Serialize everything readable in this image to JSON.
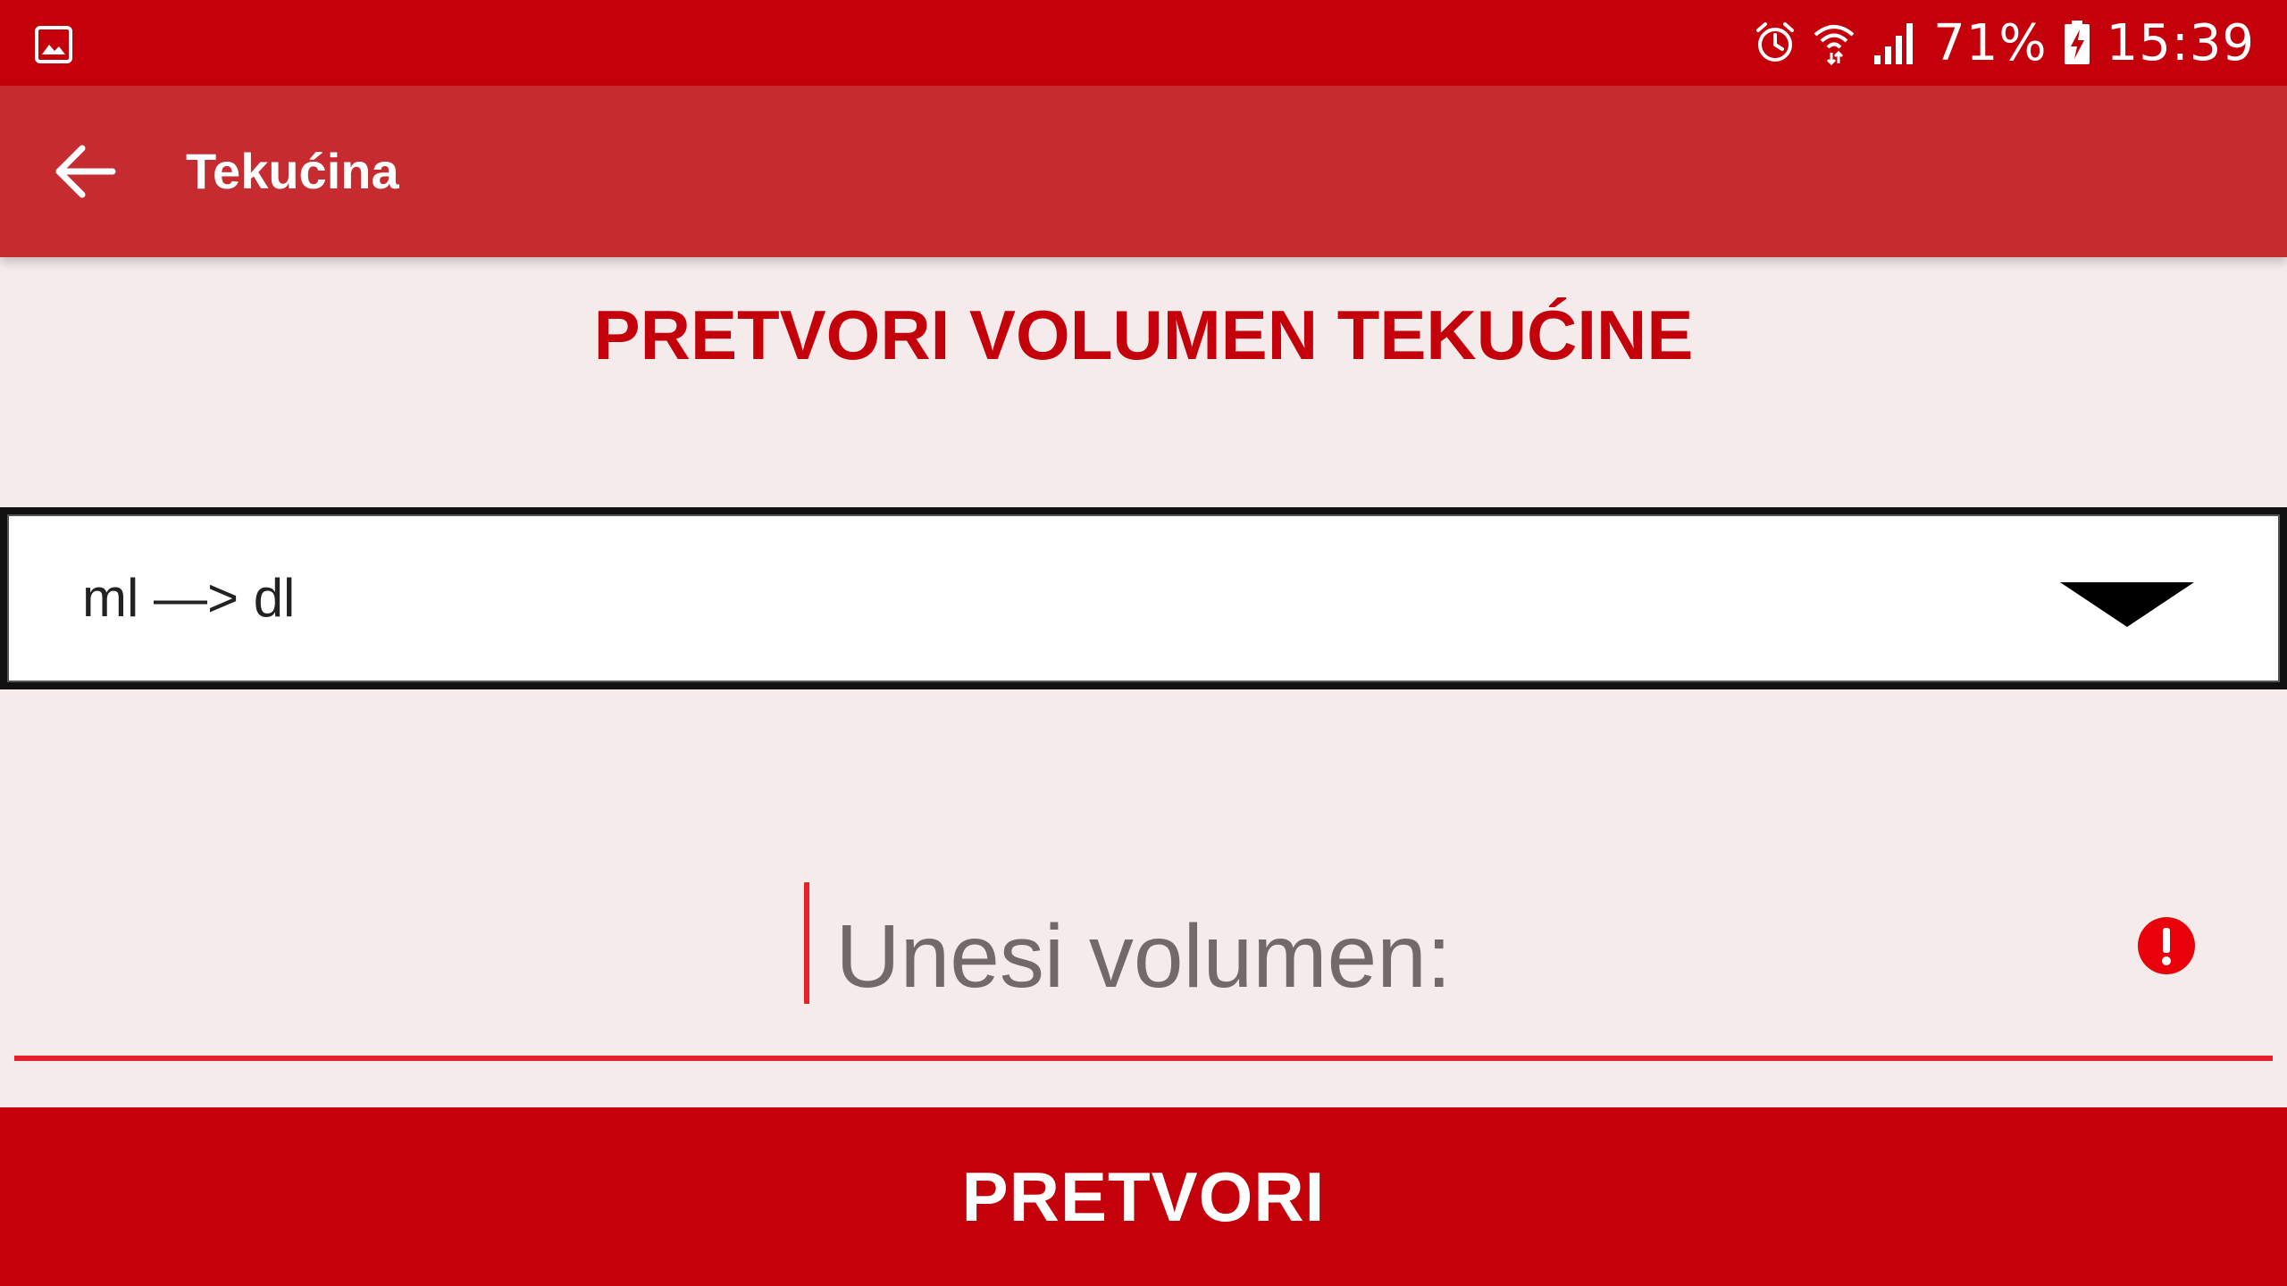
{
  "status_bar": {
    "battery_percent": "71%",
    "time": "15:39",
    "icons": [
      "gallery-notification-icon",
      "alarm-icon",
      "wifi-icon",
      "signal-icon",
      "battery-charging-icon"
    ]
  },
  "app_bar": {
    "title": "Tekućina",
    "back_icon": "arrow-left-icon"
  },
  "main": {
    "heading": "PRETVORI VOLUMEN TEKUĆINE",
    "spinner": {
      "selected": "ml —> dl",
      "dropdown_icon": "triangle-down-icon"
    },
    "volume_input": {
      "value": "",
      "placeholder": "Unesi volumen:",
      "error_icon": "error-icon"
    },
    "convert_button": {
      "label": "PRETVORI"
    }
  },
  "colors": {
    "status_bar": "#c4000b",
    "app_bar": "#c62b30",
    "background": "#f5ebea",
    "accent": "#e8202a",
    "heading": "#c4000b"
  }
}
